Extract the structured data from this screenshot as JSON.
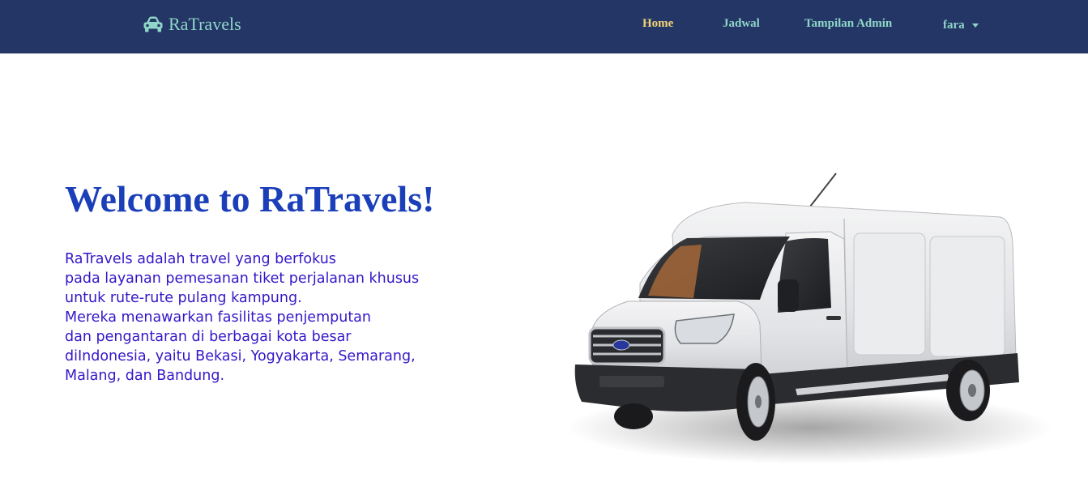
{
  "brand": {
    "name": "RaTravels",
    "icon": "car-icon"
  },
  "nav": {
    "items": [
      {
        "label": "Home",
        "active": true
      },
      {
        "label": "Jadwal",
        "active": false
      },
      {
        "label": "Tampilan Admin",
        "active": false
      }
    ],
    "user": {
      "label": "fara",
      "icon": "caret-down-icon"
    }
  },
  "hero": {
    "title": "Welcome to RaTravels!",
    "description_lines": [
      "RaTravels adalah travel yang berfokus",
      "pada layanan pemesanan tiket perjalanan khusus",
      "untuk rute-rute pulang kampung.",
      "Mereka menawarkan fasilitas penjemputan",
      "dan pengantaran di berbagai kota besar",
      "diIndonesia, yaitu Bekasi, Yogyakarta, Semarang,",
      "Malang, dan Bandung."
    ],
    "image": "white-van-image"
  },
  "colors": {
    "navbar": "#243665",
    "nav_link": "#8fd6c9",
    "nav_active": "#f2d478",
    "title": "#1b3fb8",
    "description": "#3516c7"
  }
}
